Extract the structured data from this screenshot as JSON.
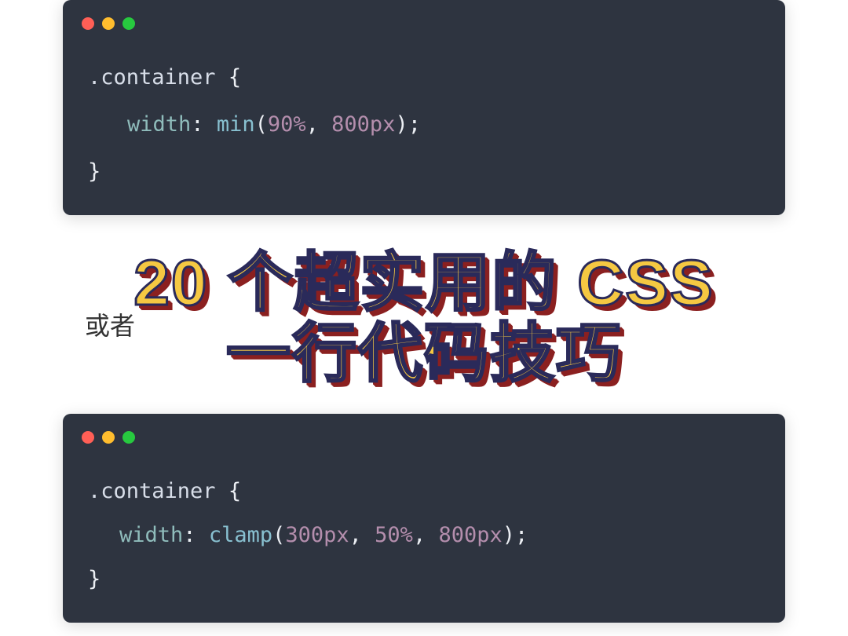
{
  "colors": {
    "code_bg": "#2e3440",
    "selector": "#d8dee9",
    "property": "#8fbcbb",
    "function": "#88c0d0",
    "punctuation": "#eceff4",
    "number": "#b48ead",
    "headline_fill": "#f5c842",
    "headline_stroke": "#2a2a5a",
    "headline_shadow": "#8b2020"
  },
  "block1": {
    "selector": ".container",
    "brace_open": "{",
    "property": "width",
    "colon": ":",
    "function": "min",
    "paren_open": "(",
    "arg1": "90%",
    "comma": ", ",
    "arg2": "800px",
    "paren_close": ")",
    "semicolon": ";",
    "brace_close": "}"
  },
  "separator": "或者",
  "block2": {
    "selector": ".container",
    "brace_open": "{",
    "property": "width",
    "colon": ":",
    "function": "clamp",
    "paren_open": "(",
    "arg1": "300px",
    "comma1": ", ",
    "arg2": "50%",
    "comma2": ", ",
    "arg3": "800px",
    "paren_close": ")",
    "semicolon": ";",
    "brace_close": "}"
  },
  "headline": {
    "line1": "20 个超实用的 CSS",
    "line2": "一行代码技巧"
  }
}
